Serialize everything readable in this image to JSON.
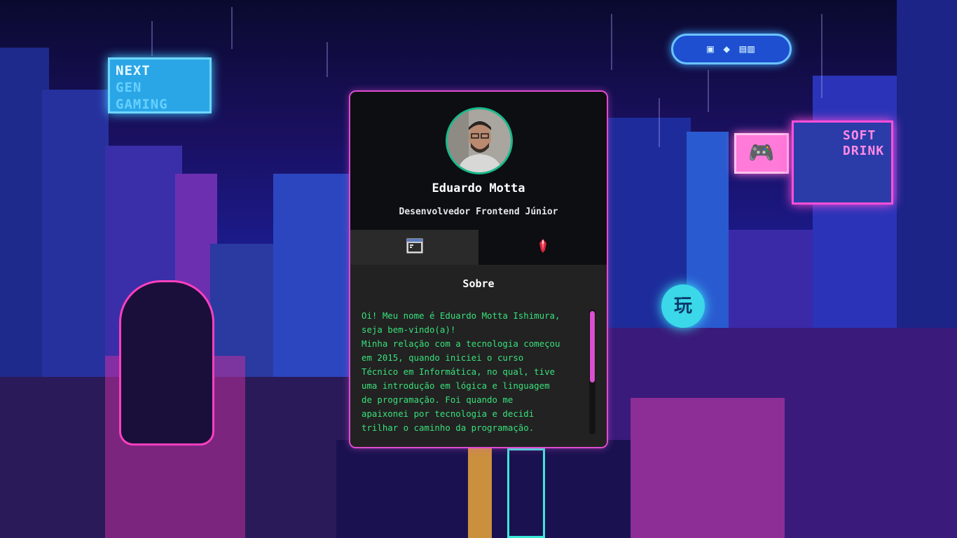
{
  "profile": {
    "name": "Eduardo Motta",
    "role": "Desenvolvedor Frontend Júnior"
  },
  "tabs": [
    {
      "icon": "terminal-window-icon",
      "active": true
    },
    {
      "icon": "crystal-gem-icon",
      "active": false
    }
  ],
  "about": {
    "title": "Sobre",
    "text": "Oi! Meu nome é Eduardo Motta Ishimura,\nseja bem-vindo(a)!\nMinha relação com a tecnologia começou\nem 2015, quando iniciei o curso\nTécnico em Informática, no qual, tive\numa introdução em lógica e linguagem\nde programação. Foi quando me\napaixonei por tecnologia e decidi\ntrilhar o caminho da programação."
  },
  "background_signs": {
    "next_gen": [
      "NEXT",
      "GEN",
      "GAMING"
    ],
    "soft_drink": [
      "SOFT",
      "DRINK"
    ]
  },
  "colors": {
    "card_border": "#e04bd0",
    "avatar_ring": "#19b98a",
    "about_text": "#39e07a",
    "scrollbar": "#d94fd0"
  }
}
